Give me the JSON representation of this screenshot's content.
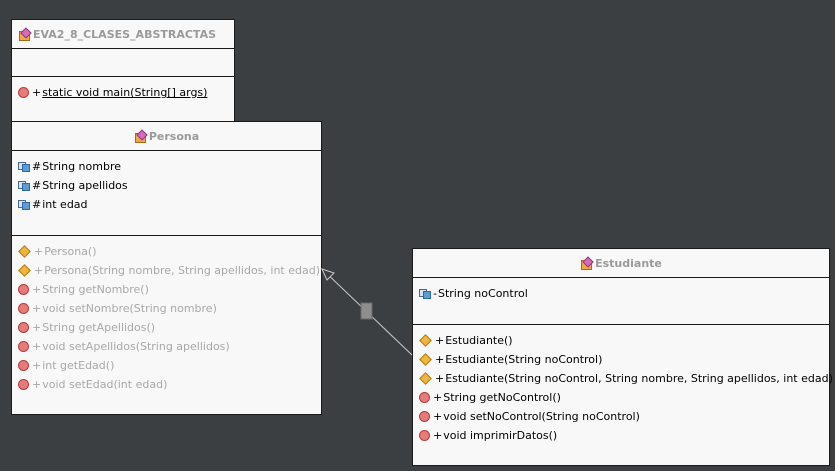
{
  "main_class": {
    "name": "EVA2_8_CLASES_ABSTRACTAS",
    "attributes": [],
    "methods": [
      {
        "vis": "+",
        "sig": "static void main(String[] args)",
        "kind": "method",
        "static": true
      }
    ]
  },
  "persona": {
    "name": "Persona",
    "attributes": [
      {
        "vis": "#",
        "sig": "String nombre"
      },
      {
        "vis": "#",
        "sig": "String apellidos"
      },
      {
        "vis": "#",
        "sig": "int edad"
      }
    ],
    "methods": [
      {
        "vis": "+",
        "sig": "Persona()",
        "kind": "constructor"
      },
      {
        "vis": "+",
        "sig": "Persona(String nombre, String apellidos, int edad)",
        "kind": "constructor"
      },
      {
        "vis": "+",
        "sig": "String getNombre()",
        "kind": "method"
      },
      {
        "vis": "+",
        "sig": "void setNombre(String nombre)",
        "kind": "method"
      },
      {
        "vis": "+",
        "sig": "String getApellidos()",
        "kind": "method"
      },
      {
        "vis": "+",
        "sig": "void setApellidos(String apellidos)",
        "kind": "method"
      },
      {
        "vis": "+",
        "sig": "int getEdad()",
        "kind": "method"
      },
      {
        "vis": "+",
        "sig": "void setEdad(int edad)",
        "kind": "method"
      }
    ]
  },
  "estudiante": {
    "name": "Estudiante",
    "attributes": [
      {
        "vis": "-",
        "sig": "String noControl"
      }
    ],
    "methods": [
      {
        "vis": "+",
        "sig": "Estudiante()",
        "kind": "constructor"
      },
      {
        "vis": "+",
        "sig": "Estudiante(String noControl)",
        "kind": "constructor"
      },
      {
        "vis": "+",
        "sig": "Estudiante(String noControl, String nombre, String apellidos, int edad)",
        "kind": "constructor"
      },
      {
        "vis": "+",
        "sig": "String getNoControl()",
        "kind": "method"
      },
      {
        "vis": "+",
        "sig": "void setNoControl(String noControl)",
        "kind": "method"
      },
      {
        "vis": "+",
        "sig": "void imprimirDatos()",
        "kind": "method"
      }
    ]
  },
  "colors": {
    "background": "#3c3f41",
    "box": "#f8f8f8",
    "title_gray": "#9a9a9a",
    "inherited_gray": "#a8a8a8",
    "relation_line": "#c8c8c8"
  }
}
